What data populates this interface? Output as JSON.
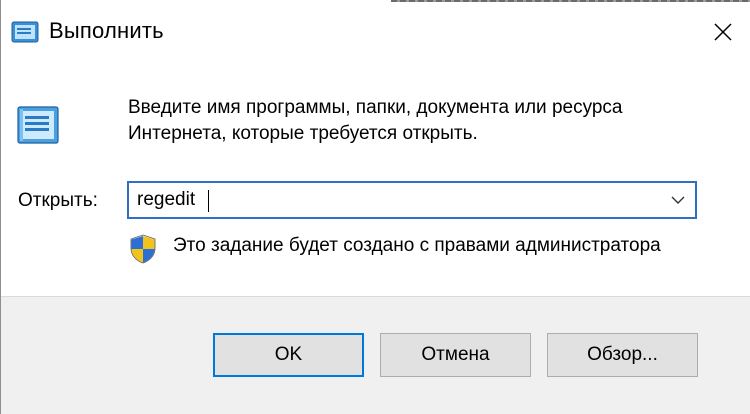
{
  "window": {
    "title": "Выполнить",
    "title_icon": "run-dialog-icon",
    "close_icon": "close-icon"
  },
  "content": {
    "description_line1": "Введите имя программы, папки, документа или ресурса",
    "description_line2": "Интернета, которые требуется открыть.",
    "open_label": "Открыть:",
    "command_value": "regedit",
    "dropdown_icon": "chevron-down-icon",
    "admin_icon": "uac-shield-icon",
    "admin_note": "Это задание будет создано с правами администратора"
  },
  "buttons": {
    "ok_label": "OK",
    "cancel_label": "Отмена",
    "browse_label": "Обзор..."
  },
  "colors": {
    "accent": "#0078d7",
    "footer_bg": "#f0f0f0",
    "button_bg": "#e1e1e1"
  }
}
